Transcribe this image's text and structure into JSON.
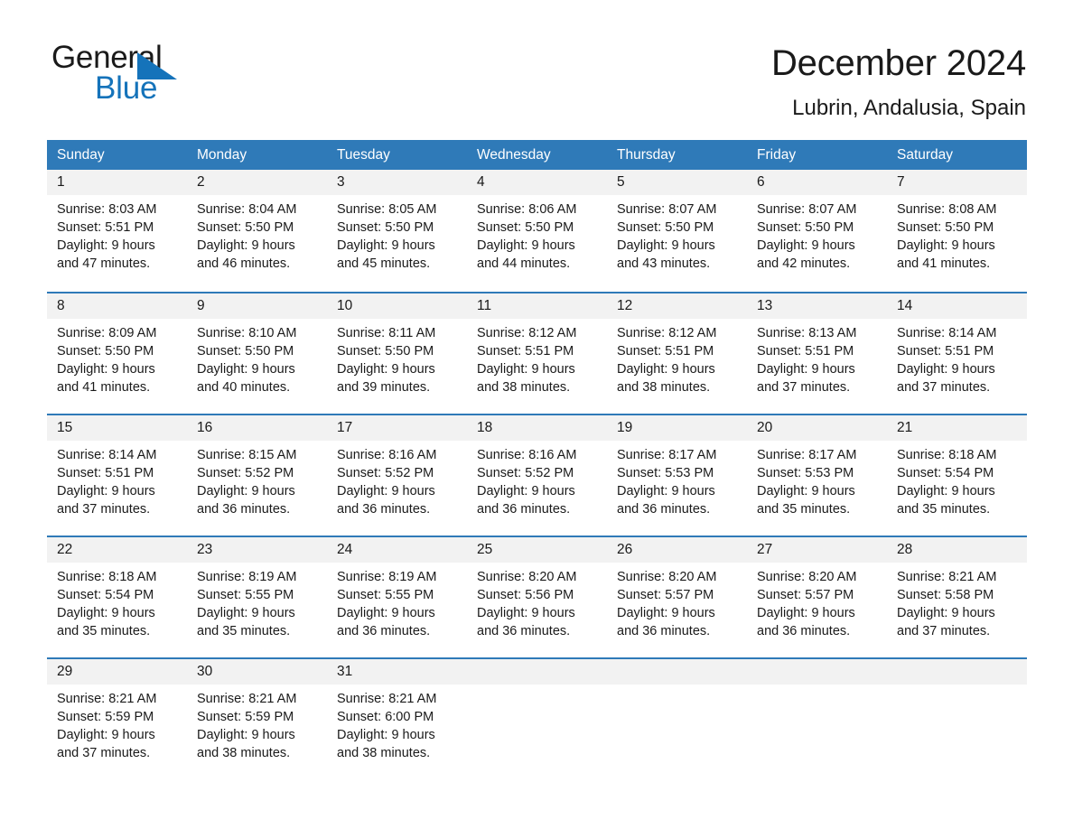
{
  "brand": {
    "name_part1": "General",
    "name_part2": "Blue",
    "accent_color": "#1573ba"
  },
  "header": {
    "title": "December 2024",
    "subtitle": "Lubrin, Andalusia, Spain"
  },
  "theme": {
    "header_blue": "#2f7ab8",
    "daynum_band": "#f2f2f2",
    "text": "#1a1a1a"
  },
  "weekdays": [
    "Sunday",
    "Monday",
    "Tuesday",
    "Wednesday",
    "Thursday",
    "Friday",
    "Saturday"
  ],
  "labels": {
    "sunrise_prefix": "Sunrise:",
    "sunset_prefix": "Sunset:",
    "daylight_prefix": "Daylight:"
  },
  "weeks": [
    [
      {
        "day": "1",
        "sunrise": "Sunrise: 8:03 AM",
        "sunset": "Sunset: 5:51 PM",
        "daylight_line1": "Daylight: 9 hours",
        "daylight_line2": "and 47 minutes."
      },
      {
        "day": "2",
        "sunrise": "Sunrise: 8:04 AM",
        "sunset": "Sunset: 5:50 PM",
        "daylight_line1": "Daylight: 9 hours",
        "daylight_line2": "and 46 minutes."
      },
      {
        "day": "3",
        "sunrise": "Sunrise: 8:05 AM",
        "sunset": "Sunset: 5:50 PM",
        "daylight_line1": "Daylight: 9 hours",
        "daylight_line2": "and 45 minutes."
      },
      {
        "day": "4",
        "sunrise": "Sunrise: 8:06 AM",
        "sunset": "Sunset: 5:50 PM",
        "daylight_line1": "Daylight: 9 hours",
        "daylight_line2": "and 44 minutes."
      },
      {
        "day": "5",
        "sunrise": "Sunrise: 8:07 AM",
        "sunset": "Sunset: 5:50 PM",
        "daylight_line1": "Daylight: 9 hours",
        "daylight_line2": "and 43 minutes."
      },
      {
        "day": "6",
        "sunrise": "Sunrise: 8:07 AM",
        "sunset": "Sunset: 5:50 PM",
        "daylight_line1": "Daylight: 9 hours",
        "daylight_line2": "and 42 minutes."
      },
      {
        "day": "7",
        "sunrise": "Sunrise: 8:08 AM",
        "sunset": "Sunset: 5:50 PM",
        "daylight_line1": "Daylight: 9 hours",
        "daylight_line2": "and 41 minutes."
      }
    ],
    [
      {
        "day": "8",
        "sunrise": "Sunrise: 8:09 AM",
        "sunset": "Sunset: 5:50 PM",
        "daylight_line1": "Daylight: 9 hours",
        "daylight_line2": "and 41 minutes."
      },
      {
        "day": "9",
        "sunrise": "Sunrise: 8:10 AM",
        "sunset": "Sunset: 5:50 PM",
        "daylight_line1": "Daylight: 9 hours",
        "daylight_line2": "and 40 minutes."
      },
      {
        "day": "10",
        "sunrise": "Sunrise: 8:11 AM",
        "sunset": "Sunset: 5:50 PM",
        "daylight_line1": "Daylight: 9 hours",
        "daylight_line2": "and 39 minutes."
      },
      {
        "day": "11",
        "sunrise": "Sunrise: 8:12 AM",
        "sunset": "Sunset: 5:51 PM",
        "daylight_line1": "Daylight: 9 hours",
        "daylight_line2": "and 38 minutes."
      },
      {
        "day": "12",
        "sunrise": "Sunrise: 8:12 AM",
        "sunset": "Sunset: 5:51 PM",
        "daylight_line1": "Daylight: 9 hours",
        "daylight_line2": "and 38 minutes."
      },
      {
        "day": "13",
        "sunrise": "Sunrise: 8:13 AM",
        "sunset": "Sunset: 5:51 PM",
        "daylight_line1": "Daylight: 9 hours",
        "daylight_line2": "and 37 minutes."
      },
      {
        "day": "14",
        "sunrise": "Sunrise: 8:14 AM",
        "sunset": "Sunset: 5:51 PM",
        "daylight_line1": "Daylight: 9 hours",
        "daylight_line2": "and 37 minutes."
      }
    ],
    [
      {
        "day": "15",
        "sunrise": "Sunrise: 8:14 AM",
        "sunset": "Sunset: 5:51 PM",
        "daylight_line1": "Daylight: 9 hours",
        "daylight_line2": "and 37 minutes."
      },
      {
        "day": "16",
        "sunrise": "Sunrise: 8:15 AM",
        "sunset": "Sunset: 5:52 PM",
        "daylight_line1": "Daylight: 9 hours",
        "daylight_line2": "and 36 minutes."
      },
      {
        "day": "17",
        "sunrise": "Sunrise: 8:16 AM",
        "sunset": "Sunset: 5:52 PM",
        "daylight_line1": "Daylight: 9 hours",
        "daylight_line2": "and 36 minutes."
      },
      {
        "day": "18",
        "sunrise": "Sunrise: 8:16 AM",
        "sunset": "Sunset: 5:52 PM",
        "daylight_line1": "Daylight: 9 hours",
        "daylight_line2": "and 36 minutes."
      },
      {
        "day": "19",
        "sunrise": "Sunrise: 8:17 AM",
        "sunset": "Sunset: 5:53 PM",
        "daylight_line1": "Daylight: 9 hours",
        "daylight_line2": "and 36 minutes."
      },
      {
        "day": "20",
        "sunrise": "Sunrise: 8:17 AM",
        "sunset": "Sunset: 5:53 PM",
        "daylight_line1": "Daylight: 9 hours",
        "daylight_line2": "and 35 minutes."
      },
      {
        "day": "21",
        "sunrise": "Sunrise: 8:18 AM",
        "sunset": "Sunset: 5:54 PM",
        "daylight_line1": "Daylight: 9 hours",
        "daylight_line2": "and 35 minutes."
      }
    ],
    [
      {
        "day": "22",
        "sunrise": "Sunrise: 8:18 AM",
        "sunset": "Sunset: 5:54 PM",
        "daylight_line1": "Daylight: 9 hours",
        "daylight_line2": "and 35 minutes."
      },
      {
        "day": "23",
        "sunrise": "Sunrise: 8:19 AM",
        "sunset": "Sunset: 5:55 PM",
        "daylight_line1": "Daylight: 9 hours",
        "daylight_line2": "and 35 minutes."
      },
      {
        "day": "24",
        "sunrise": "Sunrise: 8:19 AM",
        "sunset": "Sunset: 5:55 PM",
        "daylight_line1": "Daylight: 9 hours",
        "daylight_line2": "and 36 minutes."
      },
      {
        "day": "25",
        "sunrise": "Sunrise: 8:20 AM",
        "sunset": "Sunset: 5:56 PM",
        "daylight_line1": "Daylight: 9 hours",
        "daylight_line2": "and 36 minutes."
      },
      {
        "day": "26",
        "sunrise": "Sunrise: 8:20 AM",
        "sunset": "Sunset: 5:57 PM",
        "daylight_line1": "Daylight: 9 hours",
        "daylight_line2": "and 36 minutes."
      },
      {
        "day": "27",
        "sunrise": "Sunrise: 8:20 AM",
        "sunset": "Sunset: 5:57 PM",
        "daylight_line1": "Daylight: 9 hours",
        "daylight_line2": "and 36 minutes."
      },
      {
        "day": "28",
        "sunrise": "Sunrise: 8:21 AM",
        "sunset": "Sunset: 5:58 PM",
        "daylight_line1": "Daylight: 9 hours",
        "daylight_line2": "and 37 minutes."
      }
    ],
    [
      {
        "day": "29",
        "sunrise": "Sunrise: 8:21 AM",
        "sunset": "Sunset: 5:59 PM",
        "daylight_line1": "Daylight: 9 hours",
        "daylight_line2": "and 37 minutes."
      },
      {
        "day": "30",
        "sunrise": "Sunrise: 8:21 AM",
        "sunset": "Sunset: 5:59 PM",
        "daylight_line1": "Daylight: 9 hours",
        "daylight_line2": "and 38 minutes."
      },
      {
        "day": "31",
        "sunrise": "Sunrise: 8:21 AM",
        "sunset": "Sunset: 6:00 PM",
        "daylight_line1": "Daylight: 9 hours",
        "daylight_line2": "and 38 minutes."
      },
      {
        "day": "",
        "sunrise": "",
        "sunset": "",
        "daylight_line1": "",
        "daylight_line2": "",
        "empty": true
      },
      {
        "day": "",
        "sunrise": "",
        "sunset": "",
        "daylight_line1": "",
        "daylight_line2": "",
        "empty": true
      },
      {
        "day": "",
        "sunrise": "",
        "sunset": "",
        "daylight_line1": "",
        "daylight_line2": "",
        "empty": true
      },
      {
        "day": "",
        "sunrise": "",
        "sunset": "",
        "daylight_line1": "",
        "daylight_line2": "",
        "empty": true
      }
    ]
  ]
}
